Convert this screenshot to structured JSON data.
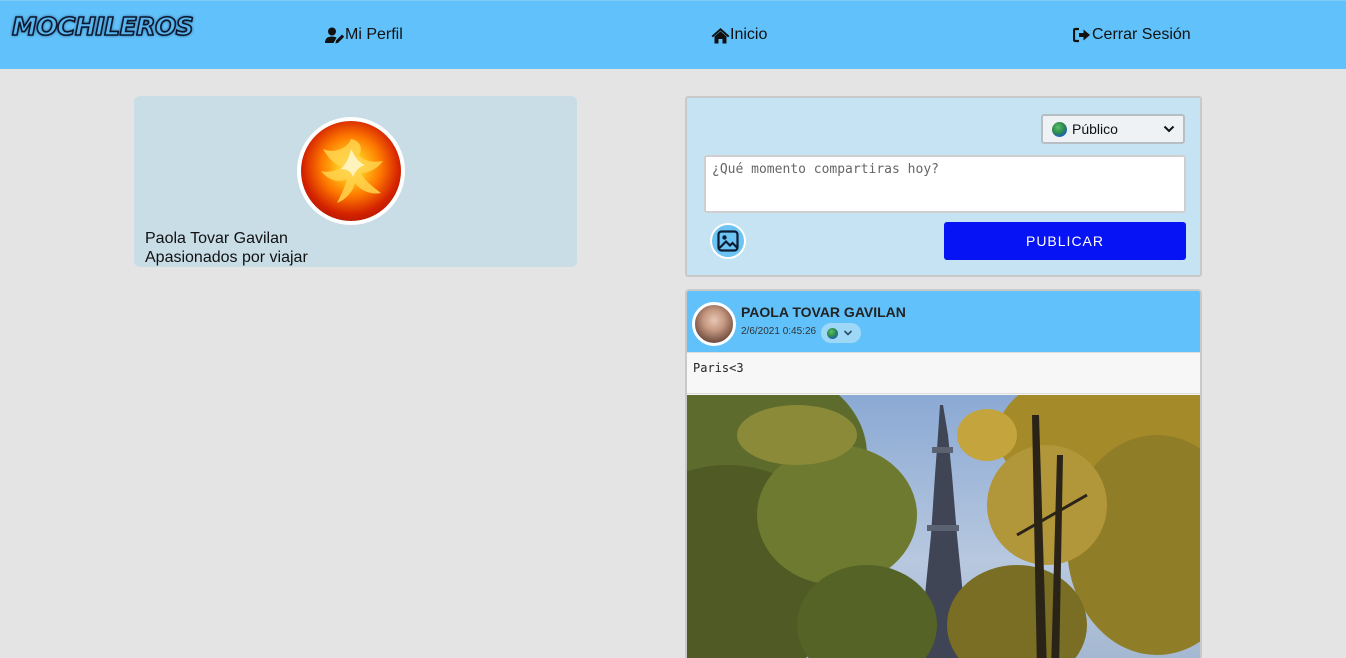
{
  "navbar": {
    "logo": "MOCHILEROS",
    "links": [
      {
        "label": "Mi Perfil",
        "icon": "user-edit-icon"
      },
      {
        "label": "Inicio",
        "icon": "home-icon"
      },
      {
        "label": "Cerrar Sesión",
        "icon": "sign-out-icon"
      }
    ],
    "background": "#61c1fa"
  },
  "profile": {
    "name": "Paola Tovar Gavilan",
    "bio": "Apasionados por viajar",
    "avatar": "phoenix-avatar"
  },
  "composer": {
    "privacy_selected": "Público",
    "placeholder": "¿Qué momento compartiras hoy?",
    "image_button_icon": "image-icon",
    "publish_label": "PUBLICAR",
    "publish_color": "#0513f5"
  },
  "post": {
    "author": "PAOLA TOVAR GAVILAN",
    "date": "2/6/2021 0:45:26",
    "privacy_icon": "globe-icon",
    "text": "Paris<3",
    "image": "eiffel-tower-photo"
  }
}
